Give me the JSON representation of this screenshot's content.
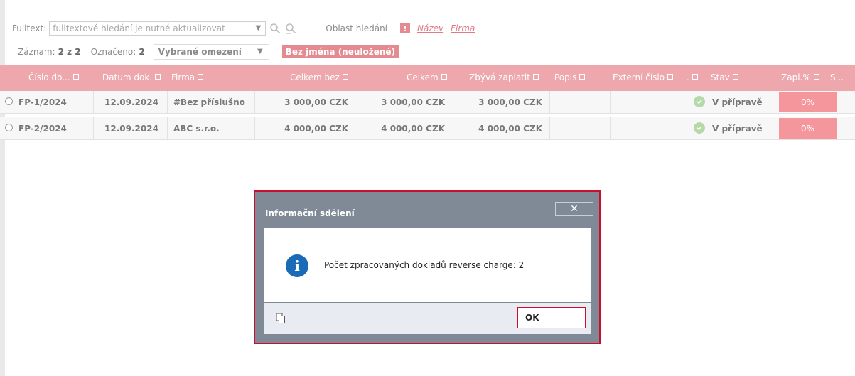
{
  "toolbar": {
    "fulltext_label": "Fulltext:",
    "fulltext_placeholder": "fulltextové hledání je nutné aktualizovat",
    "area_label": "Oblast hledání",
    "area_links": [
      "Název",
      "Firma"
    ],
    "record_label": "Záznam:",
    "record_value": "2 z 2",
    "marked_label": "Označeno:",
    "marked_value": "2",
    "filter_select": "Vybrané omezení",
    "unsaved_badge": "Bez jména (neuložené)"
  },
  "table": {
    "columns": [
      "Číslo do...",
      "Datum dok.",
      "Firma",
      "Celkem bez",
      "Celkem",
      "Zbývá zaplatit",
      "Popis",
      "Externí číslo",
      ".",
      "Stav",
      "Zapl.%",
      "S..."
    ],
    "rows": [
      {
        "cislo": "FP-1/2024",
        "datum": "12.09.2024",
        "firma": "#Bez příslušno",
        "celkem_bez": "3 000,00 CZK",
        "celkem": "3 000,00 CZK",
        "zbyva": "3 000,00 CZK",
        "popis": "",
        "externi": "",
        "stav": "V přípravě",
        "zapl": "0%"
      },
      {
        "cislo": "FP-2/2024",
        "datum": "12.09.2024",
        "firma": "ABC s.r.o.",
        "celkem_bez": "4 000,00 CZK",
        "celkem": "4 000,00 CZK",
        "zbyva": "4 000,00 CZK",
        "popis": "",
        "externi": "",
        "stav": "V přípravě",
        "zapl": "0%"
      }
    ]
  },
  "dialog": {
    "title": "Informační sdělení",
    "close": "✕",
    "message": "Počet zpracovaných dokladů reverse charge: 2",
    "ok": "OK"
  },
  "colors": {
    "header": "#eda7ad",
    "accent": "#e38b91",
    "dialog_frame": "#c8102e",
    "info_icon": "#1a6bb7"
  }
}
